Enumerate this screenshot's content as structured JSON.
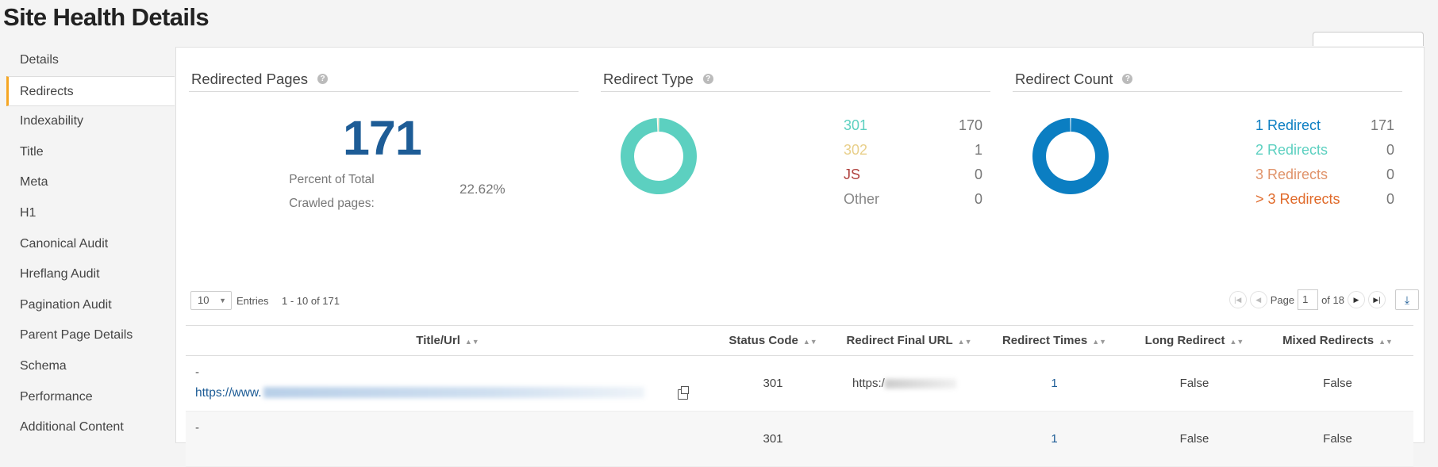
{
  "page": {
    "title": "Site Health Details"
  },
  "sidebar": {
    "items": [
      {
        "label": "Details"
      },
      {
        "label": "Redirects",
        "active": true
      },
      {
        "label": "Indexability"
      },
      {
        "label": "Title"
      },
      {
        "label": "Meta"
      },
      {
        "label": "H1"
      },
      {
        "label": "Canonical Audit"
      },
      {
        "label": "Hreflang Audit"
      },
      {
        "label": "Pagination Audit"
      },
      {
        "label": "Parent Page Details"
      },
      {
        "label": "Schema"
      },
      {
        "label": "Performance"
      },
      {
        "label": "Additional Content"
      }
    ]
  },
  "redirected_pages": {
    "title": "Redirected Pages",
    "help_icon": "?",
    "count": "171",
    "pct_label_line1": "Percent of Total",
    "pct_label_line2": "Crawled pages:",
    "pct_value": "22.62%"
  },
  "redirect_type": {
    "title": "Redirect Type",
    "help_icon": "?",
    "items": [
      {
        "label": "301",
        "value": "170",
        "color": "#5cd0c0",
        "count": 170
      },
      {
        "label": "302",
        "value": "1",
        "color": "#e8cf8a",
        "count": 1
      },
      {
        "label": "JS",
        "value": "0",
        "color": "#b0413e",
        "count": 0
      },
      {
        "label": "Other",
        "value": "0",
        "color": "#888888",
        "count": 0
      }
    ]
  },
  "redirect_count": {
    "title": "Redirect Count",
    "help_icon": "?",
    "items": [
      {
        "label": "1 Redirect",
        "value": "171",
        "color": "#0b7ec2",
        "count": 171
      },
      {
        "label": "2 Redirects",
        "value": "0",
        "color": "#5cd0c0",
        "count": 0
      },
      {
        "label": "3 Redirects",
        "value": "0",
        "color": "#e0936a",
        "count": 0
      },
      {
        "label": "> 3 Redirects",
        "value": "0",
        "color": "#e06a2a",
        "count": 0
      }
    ]
  },
  "table_controls": {
    "page_size": "10",
    "entries_label": "Entries",
    "range_label": "1 - 10 of 171",
    "page_label": "Page",
    "current_page": "1",
    "of_pages": "of 18"
  },
  "table": {
    "headers": [
      "Title/Url",
      "Status Code",
      "Redirect Final URL",
      "Redirect Times",
      "Long Redirect",
      "Mixed Redirects"
    ],
    "rows": [
      {
        "title": "-",
        "url_prefix": "https://www.",
        "status": "301",
        "final_prefix": "https:/",
        "times": "1",
        "long": "False",
        "mixed": "False"
      },
      {
        "title": "-",
        "url_prefix": "",
        "status": "301",
        "final_prefix": "",
        "times": "1",
        "long": "False",
        "mixed": "False"
      }
    ]
  }
}
